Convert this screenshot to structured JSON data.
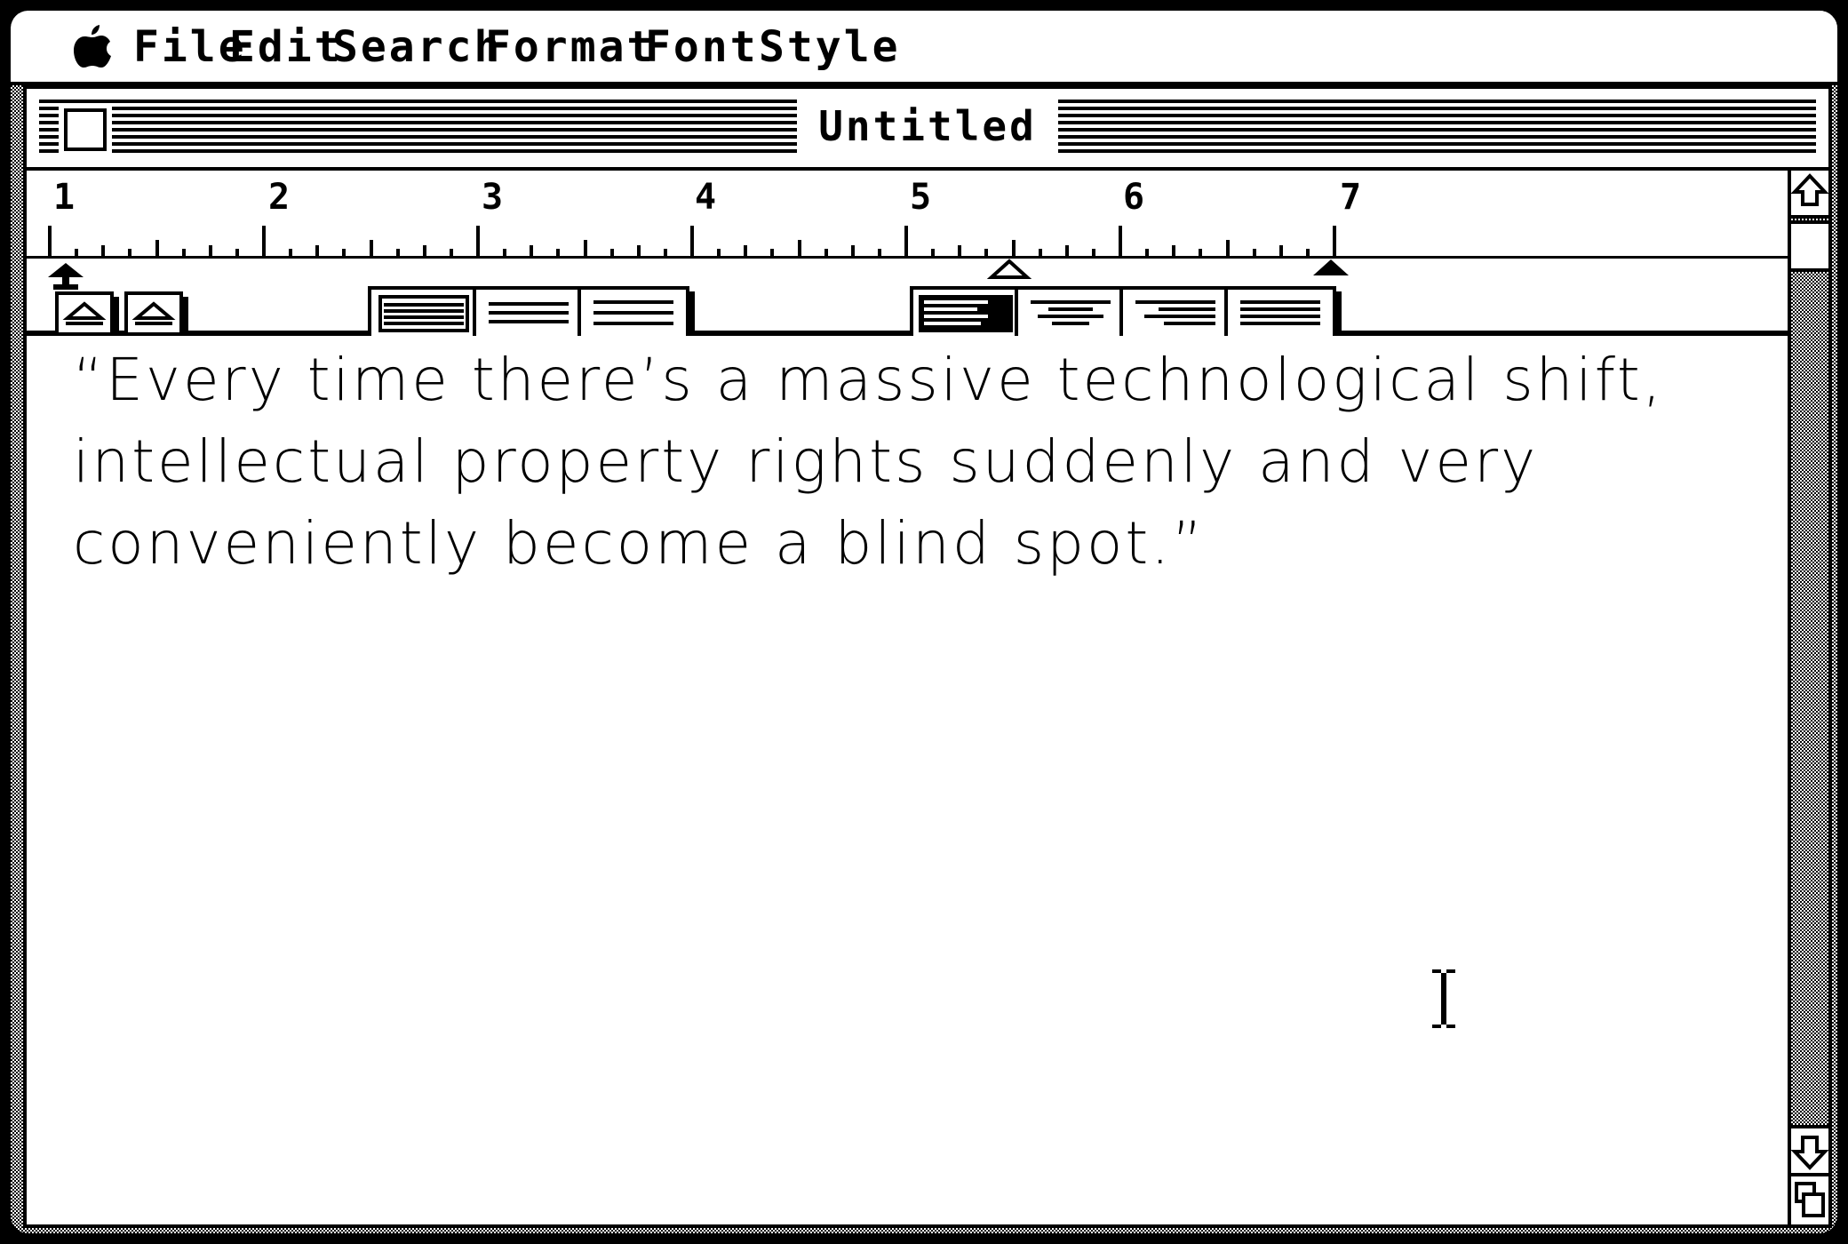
{
  "menubar": {
    "apple_icon": "apple-icon",
    "items": [
      "File",
      "Edit",
      "Search",
      "Format",
      "Font",
      "Style"
    ]
  },
  "window": {
    "title": "Untitled"
  },
  "ruler": {
    "numbers": [
      "1",
      "2",
      "3",
      "4",
      "5",
      "6",
      "7"
    ]
  },
  "document": {
    "text": "“Every time there’s a massive technological shift, intellectual property rights suddenly and very conveniently become a blind spot.”"
  },
  "icons": {
    "close": "close-box-icon",
    "scroll_up": "up-arrow-icon",
    "scroll_down": "down-arrow-icon",
    "grow": "grow-box-icon",
    "cursor": "i-beam-cursor-icon"
  },
  "colors": {
    "foreground": "#000000",
    "background": "#ffffff"
  }
}
